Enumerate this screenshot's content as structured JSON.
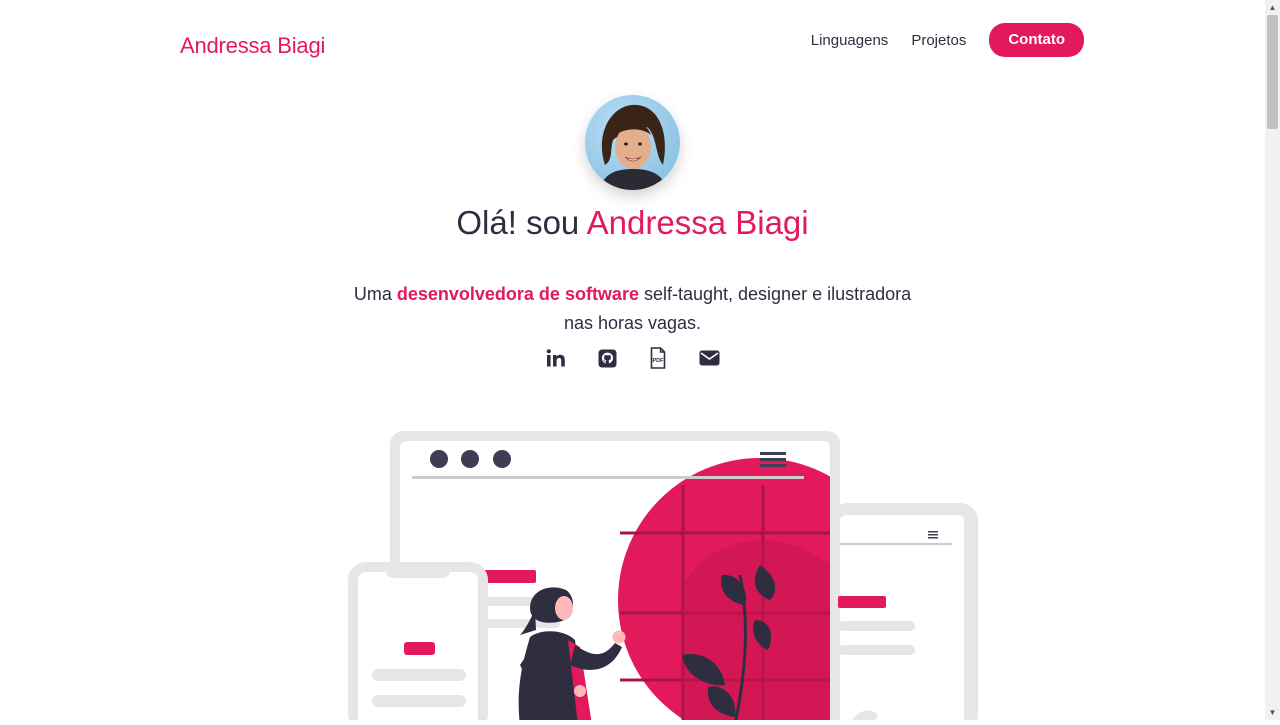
{
  "header": {
    "brand": "Andressa Biagi",
    "nav": {
      "languages": "Linguagens",
      "projects": "Projetos",
      "contact": "Contato"
    }
  },
  "hero": {
    "greeting_prefix": "Olá! sou ",
    "name": "Andressa Biagi",
    "subtitle_prefix": "Uma ",
    "subtitle_highlight": "desenvolvedora de software",
    "subtitle_suffix": " self-taught, designer e ilustradora nas horas vagas."
  },
  "socials": [
    {
      "icon": "linkedin-icon"
    },
    {
      "icon": "github-icon"
    },
    {
      "icon": "pdf-icon"
    },
    {
      "icon": "mail-icon"
    }
  ],
  "colors": {
    "accent": "#e21a5c",
    "text": "#2f2e41"
  }
}
